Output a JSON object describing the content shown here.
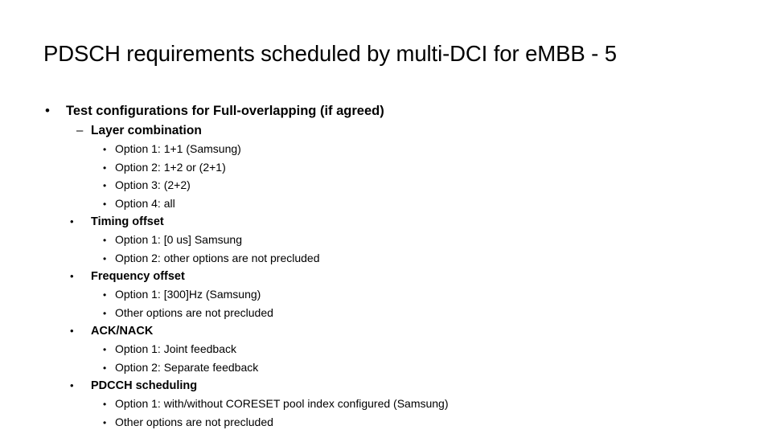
{
  "slide": {
    "title": "PDSCH requirements scheduled by multi-DCI for eMBB - 5",
    "background_color": "#ffffff",
    "text_color": "#000000",
    "bullet_glyphs": {
      "dot": "•",
      "dash": "–"
    },
    "outline": {
      "level1": {
        "text": "Test configurations for Full-overlapping (if agreed)"
      },
      "sections": [
        {
          "heading": "Layer combination",
          "heading_marker": "dash",
          "options": [
            "Option 1: 1+1 (Samsung)",
            "Option 2: 1+2 or (2+1)",
            "Option 3: (2+2)",
            "Option 4: all"
          ]
        },
        {
          "heading": "Timing offset",
          "heading_marker": "dot",
          "options": [
            "Option 1: [0 us] Samsung",
            "Option 2: other options are not precluded"
          ]
        },
        {
          "heading": "Frequency offset",
          "heading_marker": "dot",
          "options": [
            "Option 1: [300]Hz (Samsung)",
            "Other options are not precluded"
          ]
        },
        {
          "heading": "ACK/NACK",
          "heading_marker": "dot",
          "options": [
            "Option 1: Joint feedback",
            "Option 2: Separate feedback"
          ]
        },
        {
          "heading": "PDCCH scheduling",
          "heading_marker": "dot",
          "options": [
            "Option 1: with/without CORESET pool index configured (Samsung)",
            "Other options are not precluded"
          ]
        }
      ]
    }
  }
}
